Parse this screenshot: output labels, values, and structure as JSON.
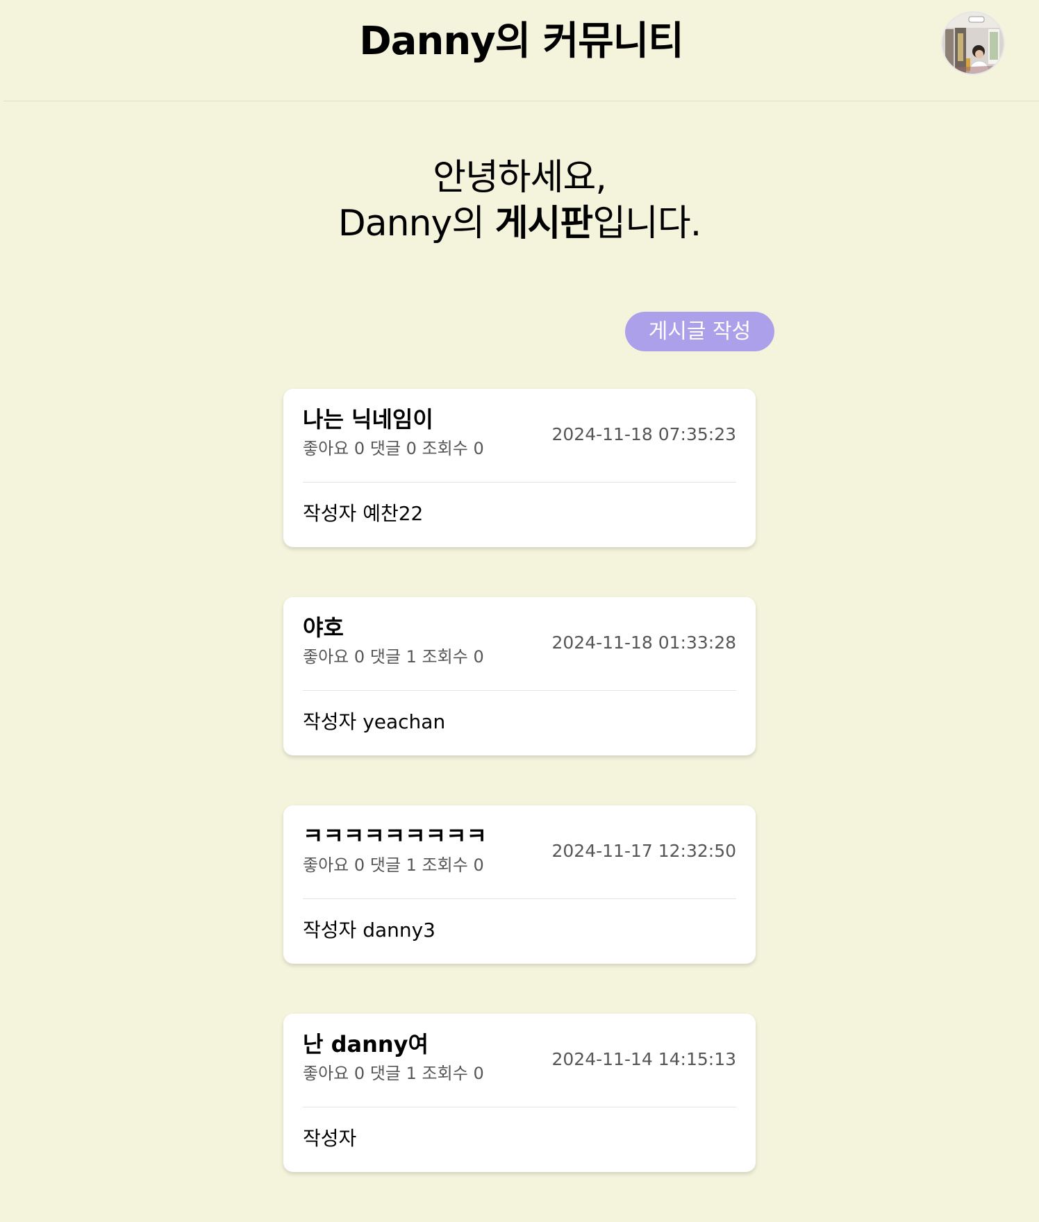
{
  "header": {
    "title": "Danny의 커뮤니티"
  },
  "welcome": {
    "line1": "안녕하세요,",
    "line2_prefix": "Danny의 ",
    "line2_bold": "게시판",
    "line2_suffix": "입니다."
  },
  "actions": {
    "write_label": "게시글 작성"
  },
  "posts": [
    {
      "title": "나는 닉네임이",
      "likes_label": "좋아요",
      "likes": "0",
      "comments_label": "댓글",
      "comments": "0",
      "views_label": "조회수",
      "views": "0",
      "date": "2024-11-18 07:35:23",
      "author_label": "작성자",
      "author": "예찬22"
    },
    {
      "title": "야호",
      "likes_label": "좋아요",
      "likes": "0",
      "comments_label": "댓글",
      "comments": "1",
      "views_label": "조회수",
      "views": "0",
      "date": "2024-11-18 01:33:28",
      "author_label": "작성자",
      "author": "yeachan"
    },
    {
      "title": "ㅋㅋㅋㅋㅋㅋㅋㅋㅋ",
      "likes_label": "좋아요",
      "likes": "0",
      "comments_label": "댓글",
      "comments": "1",
      "views_label": "조회수",
      "views": "0",
      "date": "2024-11-17 12:32:50",
      "author_label": "작성자",
      "author": "danny3"
    },
    {
      "title": "난 danny여",
      "likes_label": "좋아요",
      "likes": "0",
      "comments_label": "댓글",
      "comments": "1",
      "views_label": "조회수",
      "views": "0",
      "date": "2024-11-14 14:15:13",
      "author_label": "작성자",
      "author": ""
    }
  ]
}
